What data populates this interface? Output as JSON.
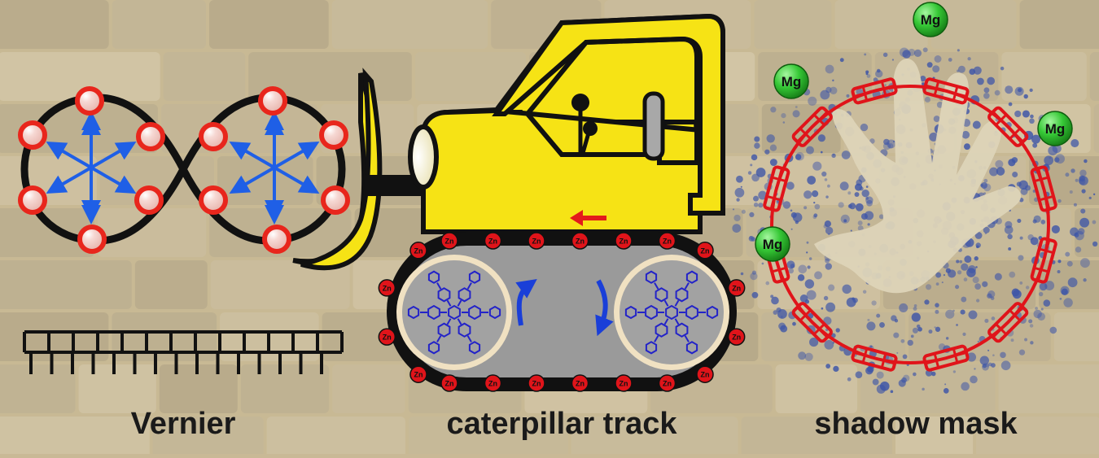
{
  "panels": {
    "vernier": {
      "caption": "Vernier"
    },
    "caterpillar": {
      "caption": "caterpillar track",
      "metal_label": "Zn"
    },
    "shadow_mask": {
      "caption": "shadow mask",
      "metal_label": "Mg"
    }
  },
  "colors": {
    "background": "#c9b996",
    "bead_red": "#e8261c",
    "arrow_blue": "#1f5fe6",
    "bulldozer_yellow": "#f6e315",
    "track_black": "#111111",
    "molecule_blue": "#2323c8",
    "ring_red": "#e0141a",
    "mg_green": "#2fbf2f",
    "stain_blue": "#3d55a8"
  }
}
